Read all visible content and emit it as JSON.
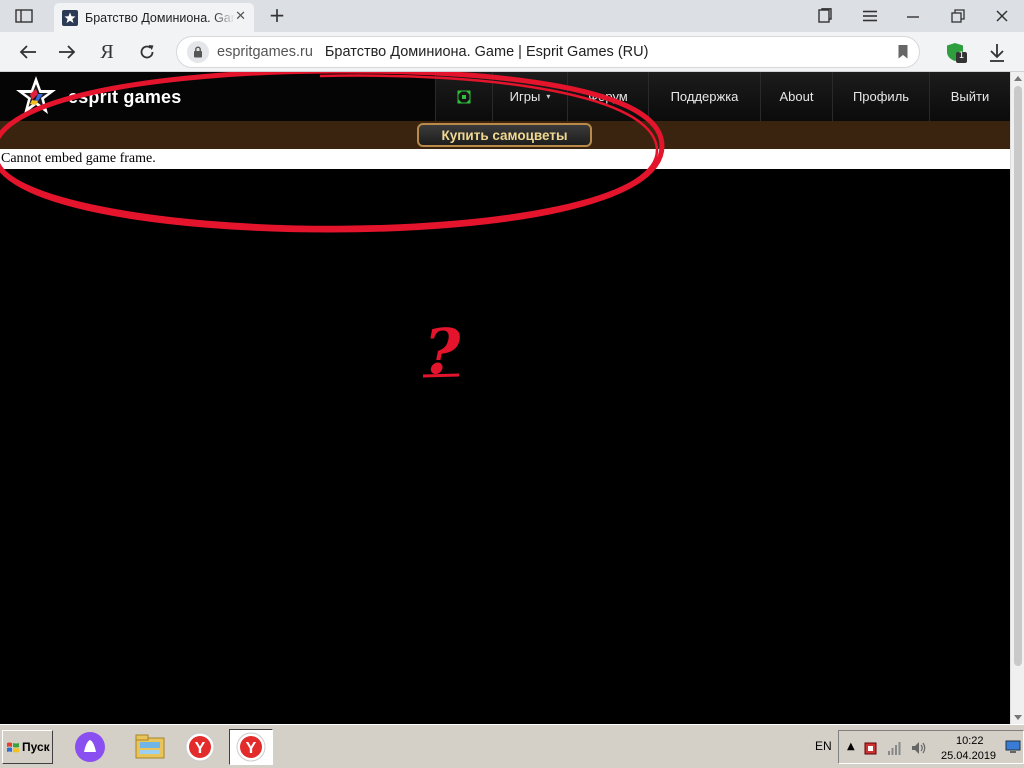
{
  "browser": {
    "tab": {
      "title": "Братство Доминиона. Game | Esprit Games (RU)",
      "close_glyph": "✕"
    },
    "new_tab_glyph": "+",
    "yandex_letter": "Я",
    "address": {
      "domain": "espritgames.ru",
      "page_title": "Братство Доминиона. Game | Esprit Games (RU)"
    },
    "protect_badge": "1"
  },
  "site": {
    "logo_text": "esprit games",
    "menu": [
      {
        "id": "fullscreen",
        "label": ""
      },
      {
        "id": "games",
        "label": "Игры",
        "caret": "▾"
      },
      {
        "id": "forum",
        "label": "Форум"
      },
      {
        "id": "support",
        "label": "Поддержка"
      },
      {
        "id": "about",
        "label": "About"
      },
      {
        "id": "profile",
        "label": "Профиль"
      },
      {
        "id": "logout",
        "label": "Выйти"
      }
    ],
    "buy_gems_label": "Купить самоцветы",
    "embed_message": "Cannot embed game frame.",
    "annotation_mark": "?"
  },
  "taskbar": {
    "start_label": "Пуск",
    "language": "EN",
    "tray_arrow": "▲",
    "time": "10:22",
    "date": "25.04.2019"
  },
  "colors": {
    "annotation_red": "#e3142b",
    "gem_bar": "#3a2410",
    "gem_text": "#f0d890"
  }
}
